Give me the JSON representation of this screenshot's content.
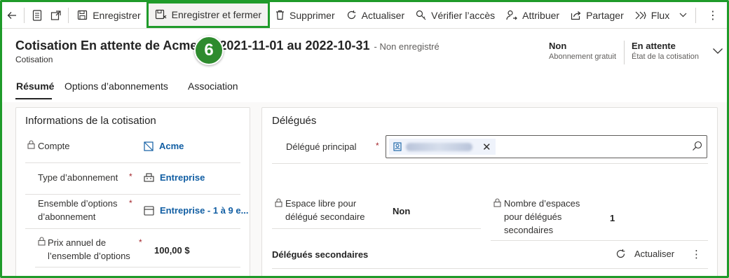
{
  "toolbar": {
    "save": "Enregistrer",
    "save_close": "Enregistrer et fermer",
    "delete": "Supprimer",
    "refresh": "Actualiser",
    "check_access": "Vérifier l’accès",
    "assign": "Attribuer",
    "share": "Partager",
    "flow": "Flux",
    "more": "⋮"
  },
  "step_badge": "6",
  "header": {
    "title": "Cotisation En attente de Acme du 2021-11-01 au 2022-10-31",
    "save_status": "- Non enregistré",
    "entity": "Cotisation",
    "fields": [
      {
        "value": "Non",
        "label": "Abonnement gratuit"
      },
      {
        "value": "En attente",
        "label": "État de la cotisation"
      }
    ]
  },
  "tabs": [
    "Résumé",
    "Options d’abonnements",
    "Association"
  ],
  "left_section": {
    "title": "Informations de la cotisation",
    "account_label": "Compte",
    "account_value": "Acme",
    "membership_type_label": "Type d’abonnement",
    "membership_type_value": "Entreprise",
    "option_set_label_1": "Ensemble d’options",
    "option_set_label_2": "d’abonnement",
    "option_set_value": "Entreprise - 1 à 9 e...",
    "price_label_1": "Prix annuel de",
    "price_label_2": "l’ensemble d’options",
    "price_value": "100,00 $",
    "required_mark": "*"
  },
  "right_section": {
    "title": "Délégués",
    "primary_label": "Délégué principal",
    "free_space_label_1": "Espace libre pour",
    "free_space_label_2": "délégué secondaire",
    "free_space_value": "Non",
    "spaces_label_1": "Nombre d’espaces",
    "spaces_label_2": "pour délégués",
    "spaces_label_3": "secondaires",
    "spaces_value": "1",
    "secondary_title": "Délégués secondaires",
    "refresh": "Actualiser",
    "more": "⋮"
  },
  "colors": {
    "highlight": "#1f9b2a",
    "badge": "#2e8b2e",
    "link": "#115ea3",
    "required": "#a4262c"
  }
}
